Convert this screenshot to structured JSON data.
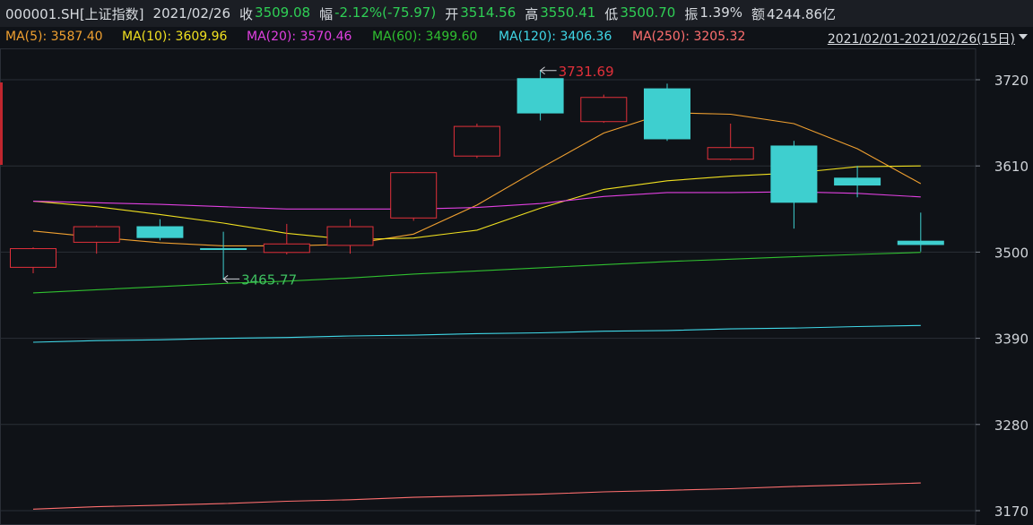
{
  "header": {
    "symbol": "000001.SH[上证指数]",
    "date": "2021/02/26",
    "close_label": "收",
    "close_value": "3509.08",
    "change_label": "幅",
    "change_value": "-2.12%(-75.97)",
    "open_label": "开",
    "open_value": "3514.56",
    "high_label": "高",
    "high_value": "3550.41",
    "low_label": "低",
    "low_value": "3500.70",
    "amp_label": "振",
    "amp_value": "1.39%",
    "amount_label": "额",
    "amount_value": "4244.86亿"
  },
  "ma_bar": {
    "items": [
      {
        "label": "MA(5): 3587.40",
        "color": "#f0a030"
      },
      {
        "label": "MA(10): 3609.96",
        "color": "#f0e020"
      },
      {
        "label": "MA(20): 3570.46",
        "color": "#e040e0"
      },
      {
        "label": "MA(60): 3499.60",
        "color": "#30c030"
      },
      {
        "label": "MA(120): 3406.36",
        "color": "#40d8e8"
      },
      {
        "label": "MA(250): 3205.32",
        "color": "#ff6f6f"
      }
    ],
    "range": "2021/02/01-2021/02/26(15日)"
  },
  "colors": {
    "up": "#e0303a",
    "down": "#3ecfcf",
    "grid": "#2a2f37",
    "axis_text": "#cfd3d8"
  },
  "chart_data": {
    "type": "candlestick",
    "ylim": [
      3160,
      3760
    ],
    "y_ticks": [
      3720,
      3610,
      3500,
      3390,
      3280,
      3170
    ],
    "candles": [
      {
        "open": 3480,
        "close": 3505,
        "high": 3506,
        "low": 3473
      },
      {
        "open": 3512,
        "close": 3533,
        "high": 3534,
        "low": 3498
      },
      {
        "open": 3533,
        "close": 3518,
        "high": 3542,
        "low": 3515
      },
      {
        "open": 3505,
        "close": 3503,
        "high": 3526,
        "low": 3465.77
      },
      {
        "open": 3499,
        "close": 3511,
        "high": 3536,
        "low": 3497
      },
      {
        "open": 3508,
        "close": 3533,
        "high": 3542,
        "low": 3498
      },
      {
        "open": 3543,
        "close": 3602,
        "high": 3602,
        "low": 3540
      },
      {
        "open": 3622,
        "close": 3661,
        "high": 3664,
        "low": 3620
      },
      {
        "open": 3722,
        "close": 3677,
        "high": 3731.69,
        "low": 3668
      },
      {
        "open": 3666,
        "close": 3698,
        "high": 3701,
        "low": 3665
      },
      {
        "open": 3709,
        "close": 3644,
        "high": 3715,
        "low": 3642
      },
      {
        "open": 3618,
        "close": 3634,
        "high": 3664,
        "low": 3617
      },
      {
        "open": 3636,
        "close": 3563,
        "high": 3642,
        "low": 3530
      },
      {
        "open": 3595,
        "close": 3585,
        "high": 3610,
        "low": 3570
      },
      {
        "open": 3514.56,
        "close": 3509.08,
        "high": 3550.41,
        "low": 3500.7
      }
    ],
    "annotations": [
      {
        "text": "3731.69",
        "candle": 8,
        "value": 3731.69,
        "color": "#e0303a"
      },
      {
        "text": "3465.77",
        "candle": 3,
        "value": 3465.77,
        "color": "#3ec060"
      }
    ],
    "ma_lines": [
      {
        "name": "MA5",
        "color": "#f0a030",
        "values": [
          3527,
          3519,
          3512,
          3508,
          3508,
          3510,
          3523,
          3560,
          3607,
          3652,
          3678,
          3676,
          3664,
          3632,
          3587.4
        ]
      },
      {
        "name": "MA10",
        "color": "#f0e020",
        "values": [
          3565,
          3558,
          3548,
          3537,
          3524,
          3516,
          3518,
          3528,
          3556,
          3580,
          3591,
          3597,
          3601,
          3609,
          3609.96
        ]
      },
      {
        "name": "MA20",
        "color": "#e040e0",
        "values": [
          3565,
          3563,
          3561,
          3558,
          3555,
          3555,
          3555,
          3557,
          3562,
          3571,
          3576,
          3576,
          3577,
          3575,
          3570.46
        ]
      },
      {
        "name": "MA60",
        "color": "#30c030",
        "values": [
          3448,
          3452,
          3456,
          3460,
          3463,
          3467,
          3472,
          3476,
          3480,
          3484,
          3488,
          3491,
          3494,
          3497,
          3499.6
        ]
      },
      {
        "name": "MA120",
        "color": "#40d8e8",
        "values": [
          3385,
          3387,
          3388,
          3390,
          3391,
          3393,
          3394,
          3396,
          3397,
          3399,
          3400,
          3402,
          3403,
          3405,
          3406.36
        ]
      },
      {
        "name": "MA250",
        "color": "#ff6f6f",
        "values": [
          3172,
          3175,
          3177,
          3179,
          3182,
          3184,
          3187,
          3189,
          3191,
          3194,
          3196,
          3198,
          3201,
          3203,
          3205.32
        ]
      }
    ]
  }
}
